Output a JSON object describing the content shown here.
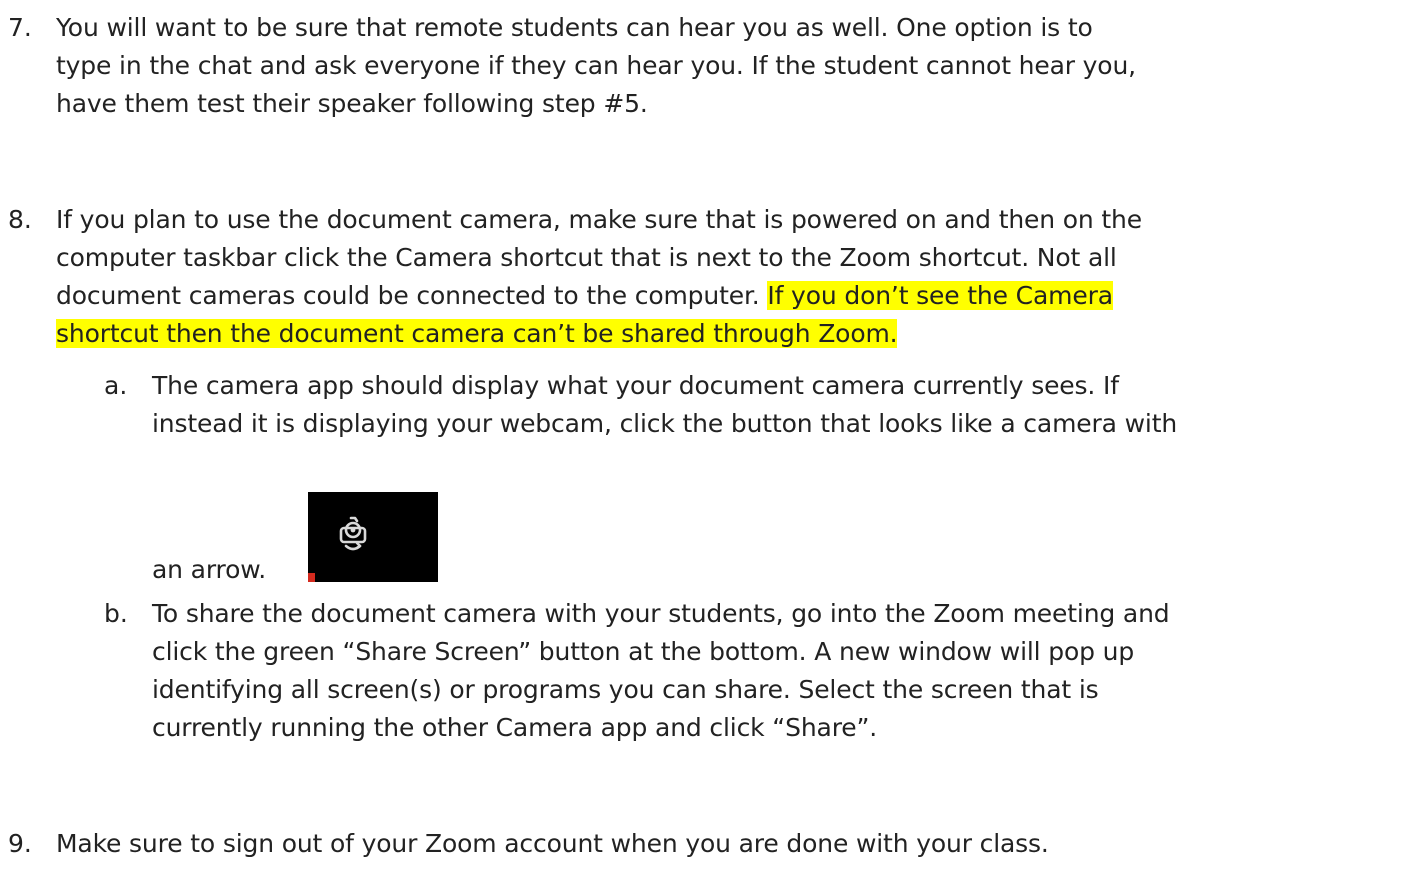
{
  "items": [
    {
      "number": "7.",
      "lines": [
        "You will want to be sure that remote students can hear you as well. One option is to",
        "type in the chat and ask everyone if they can hear you.   If the student cannot hear you,",
        "have them test their speaker following step #5."
      ]
    },
    {
      "number": "8.",
      "lines": [
        "If you plan to use the document camera, make sure that is powered on and then on the",
        "computer taskbar click the Camera shortcut that is next to the Zoom shortcut.  Not all"
      ],
      "line3_plain": "document cameras could be connected to the computer.  ",
      "line3_highlight": "If you don’t see the Camera",
      "line4_highlight": "shortcut then the document camera can’t be shared through Zoom.",
      "subitems": [
        {
          "letter": "a.",
          "lines": [
            "The camera app should display what your document camera currently sees. If",
            "instead it is displaying your webcam, click the button that looks like a camera with",
            "an arrow."
          ],
          "icon": "camera-switch-icon"
        },
        {
          "letter": "b.",
          "lines": [
            "To share the document camera with your students, go into the Zoom meeting and",
            "click the green “Share Screen” button at the bottom. A new window will pop up",
            "identifying all screen(s) or programs you can share. Select the screen that is",
            "currently running the other Camera app and click “Share”."
          ]
        }
      ]
    },
    {
      "number": "9.",
      "lines": [
        "Make sure to sign out of your Zoom account when you are done with your class."
      ]
    }
  ],
  "colors": {
    "text": "#222222",
    "highlight": "#ffff00",
    "icon_background": "#000000",
    "icon_foreground": "#d9d9d9",
    "marker": "#d42a1e"
  }
}
